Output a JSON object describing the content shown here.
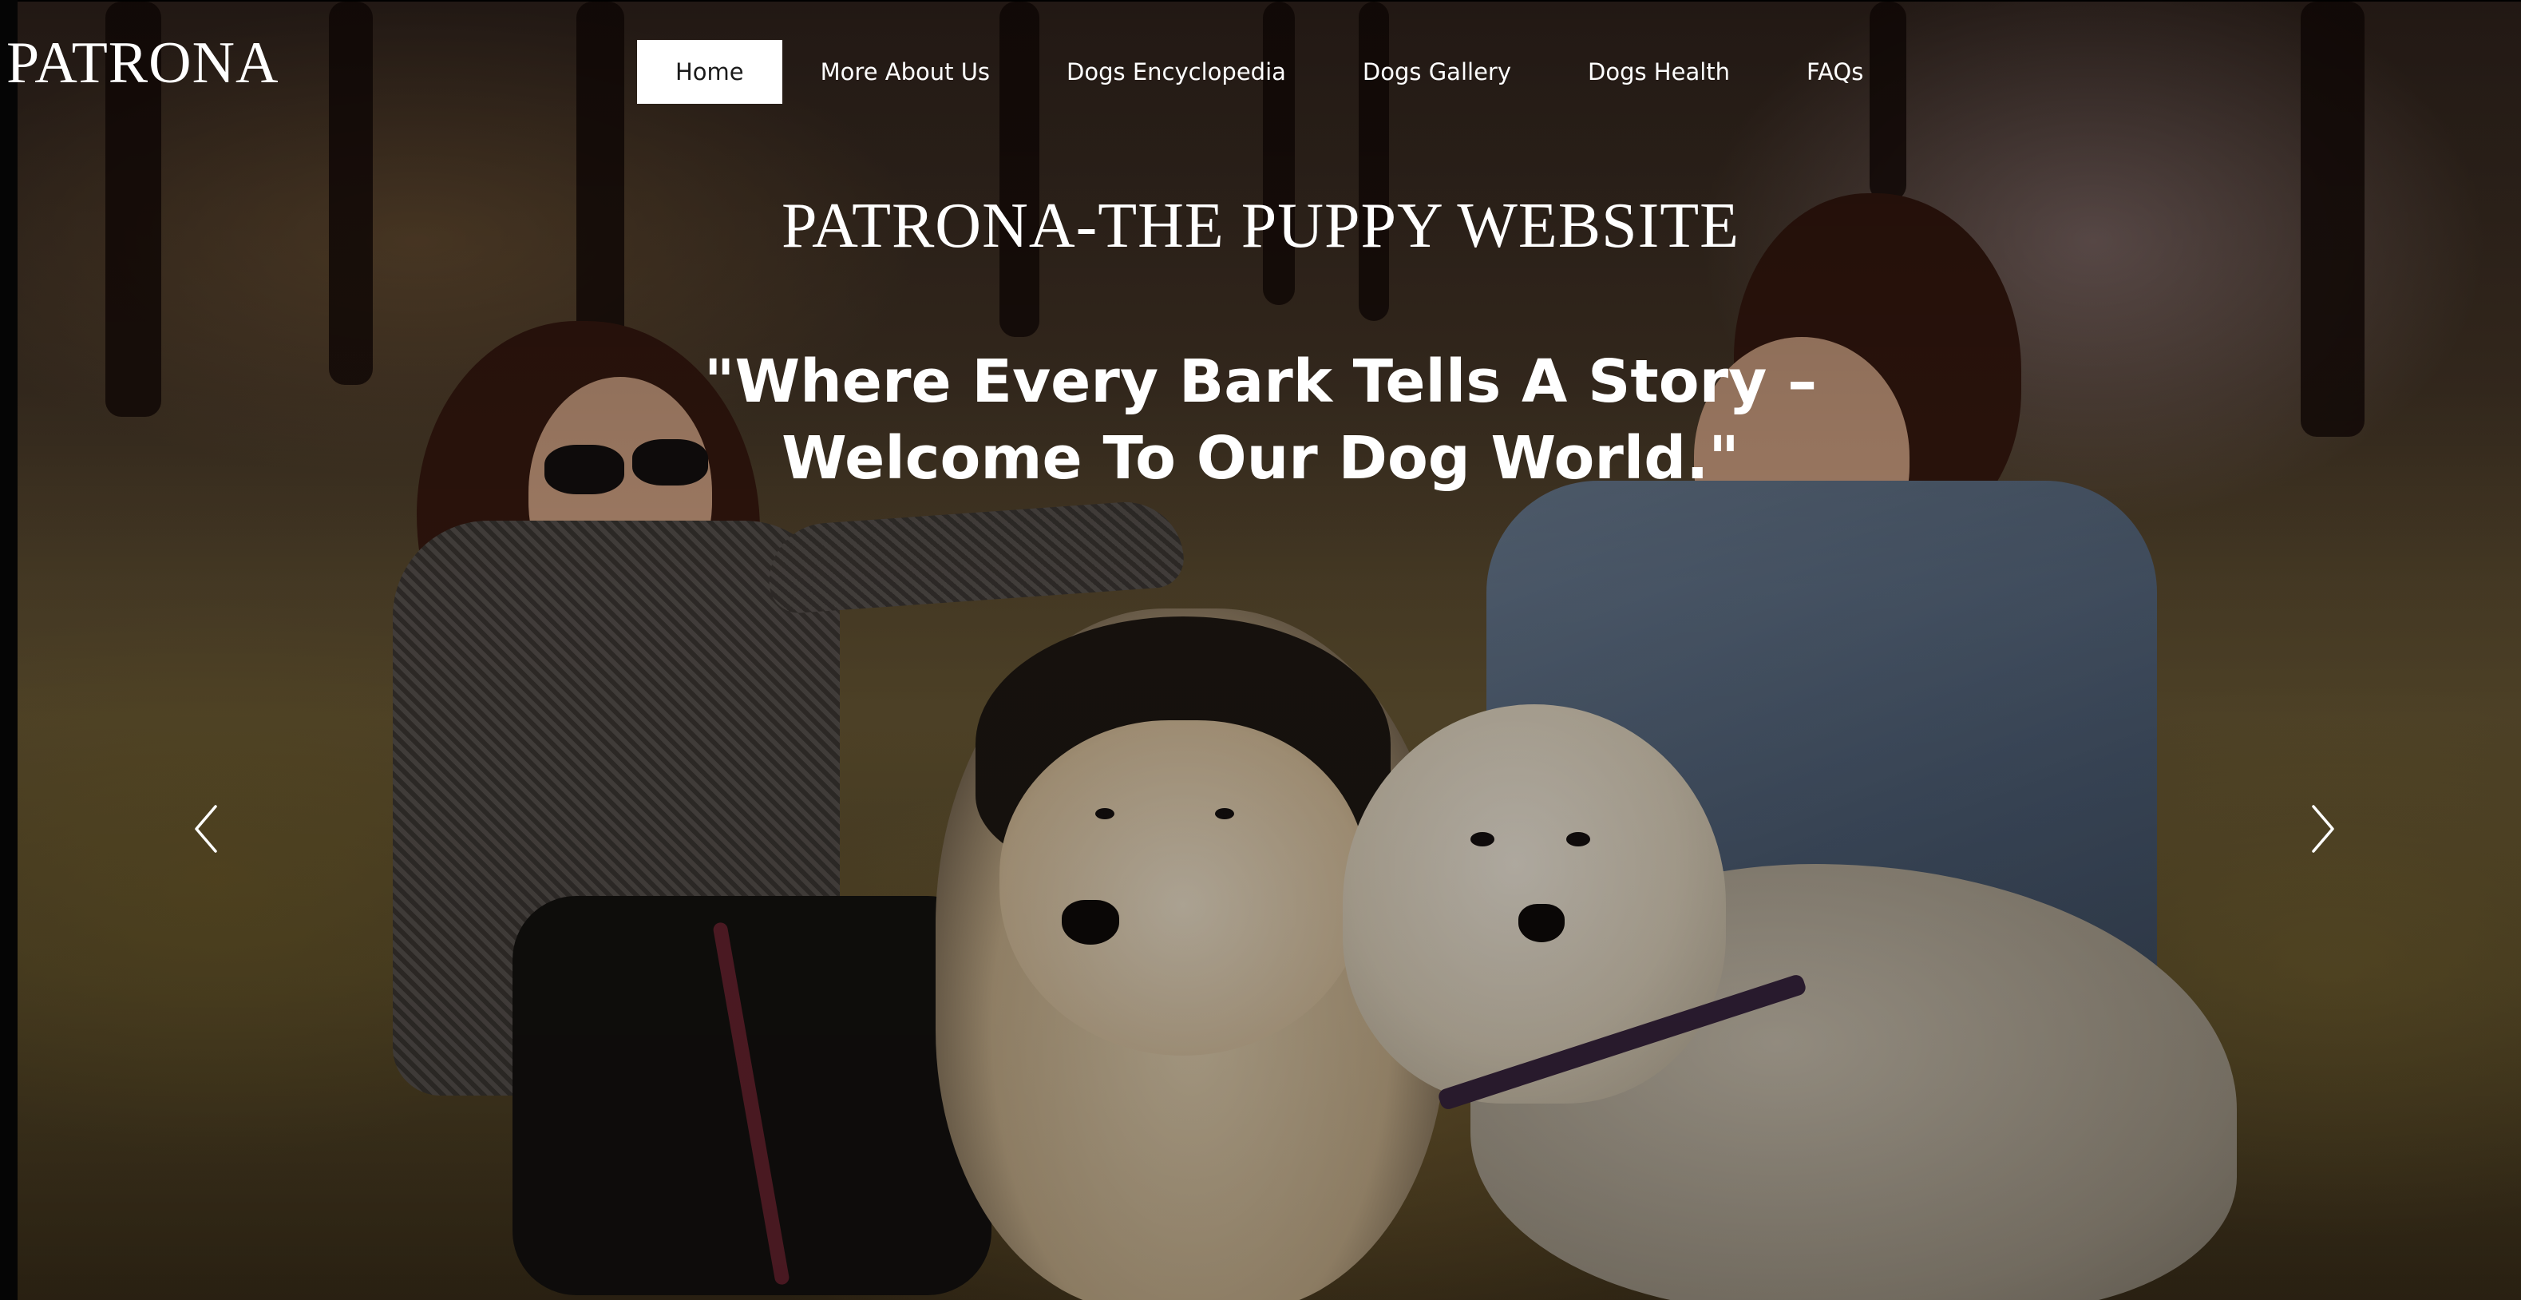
{
  "brand": {
    "logo_text": "PATRONA"
  },
  "nav": {
    "items": [
      {
        "label": "Home",
        "active": true
      },
      {
        "label": "More About Us",
        "active": false
      },
      {
        "label": "Dogs Encyclopedia",
        "active": false
      },
      {
        "label": "Dogs Gallery",
        "active": false
      },
      {
        "label": "Dogs Health",
        "active": false
      },
      {
        "label": "FAQs",
        "active": false
      }
    ]
  },
  "hero": {
    "title": "PATRONA-THE PUPPY WEBSITE",
    "tagline": "\"Where Every Bark Tells A Story – Welcome To Our Dog World.\""
  },
  "carousel": {
    "prev_icon": "chevron-left-icon",
    "next_icon": "chevron-right-icon"
  },
  "colors": {
    "nav_active_bg": "#ffffff",
    "nav_active_text": "#1a1a1a",
    "text": "#ffffff"
  }
}
